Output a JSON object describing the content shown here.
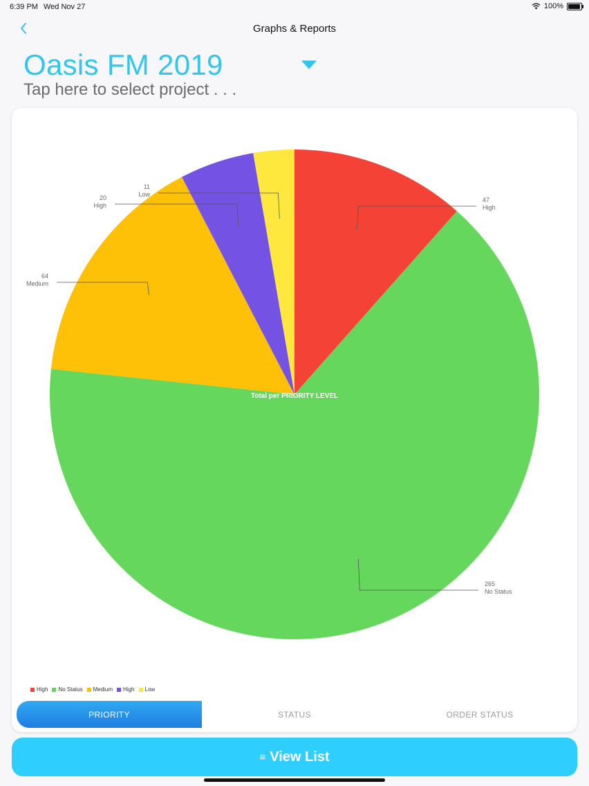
{
  "status_bar": {
    "time": "6:39 PM",
    "date": "Wed Nov 27",
    "battery": "100%"
  },
  "nav": {
    "title": "Graphs & Reports"
  },
  "project": {
    "title": "Oasis FM 2019",
    "subtitle": "Tap here to select project . . ."
  },
  "chart_data": {
    "type": "pie",
    "title": "",
    "center_label": "Total per PRIORITY LEVEL",
    "slices": [
      {
        "label": "High",
        "value": 47,
        "color": "#f44336"
      },
      {
        "label": "No Status",
        "value": 265,
        "color": "#66d75d"
      },
      {
        "label": "Medium",
        "value": 64,
        "color": "#ffc107"
      },
      {
        "label": "High",
        "value": 20,
        "color": "#7452e3"
      },
      {
        "label": "Low",
        "value": 11,
        "color": "#ffe83d"
      }
    ],
    "legend": [
      "High",
      "No Status",
      "Medium",
      "High",
      "Low"
    ],
    "legend_position": "bottom-left"
  },
  "tabs": [
    {
      "label": "PRIORITY",
      "active": true
    },
    {
      "label": "STATUS",
      "active": false
    },
    {
      "label": "ORDER STATUS",
      "active": false
    }
  ],
  "view_list": {
    "label": "View List"
  },
  "icons": {
    "back": "chevron-left-icon",
    "dropdown": "triangle-down-icon",
    "list": "list-icon",
    "wifi": "wifi-icon",
    "battery": "battery-icon"
  },
  "colors": {
    "accent": "#30c6ee",
    "button": "#2ecfff"
  }
}
